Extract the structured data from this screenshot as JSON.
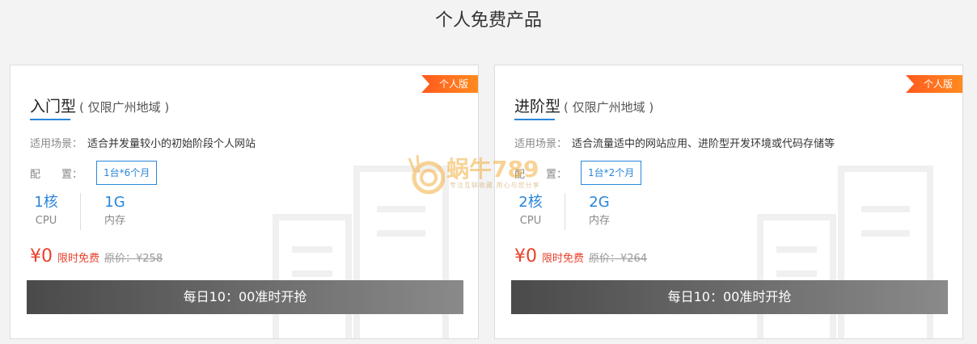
{
  "page": {
    "title": "个人免费产品"
  },
  "cards": [
    {
      "badge": "个人版",
      "name": "入门型",
      "region": "( 仅限广州地域 )",
      "scene_label": "适用场景：",
      "scene_value": "适合并发量较小的初始阶段个人网站",
      "config_label": "配　　置：",
      "config_option": "1台*6个月",
      "cpu_value": "1核",
      "cpu_label": "CPU",
      "mem_value": "1G",
      "mem_label": "内存",
      "price": "¥0",
      "free_label": "限时免费",
      "original_price": "原价：¥258",
      "button": "每日10：00准时开抢"
    },
    {
      "badge": "个人版",
      "name": "进阶型",
      "region": "( 仅限广州地域 )",
      "scene_label": "适用场景：",
      "scene_value": "适合流量适中的网站应用、进阶型开发环境或代码存储等",
      "config_label": "配　　置：",
      "config_option": "1台*2个月",
      "cpu_value": "2核",
      "cpu_label": "CPU",
      "mem_value": "2G",
      "mem_label": "内存",
      "price": "¥0",
      "free_label": "限时免费",
      "original_price": "原价：¥264",
      "button": "每日10：00准时开抢"
    }
  ],
  "watermark": {
    "text": "蜗牛789",
    "sub": "专注互联收藏 用心与您分享"
  },
  "colors": {
    "accent": "#2a86d8",
    "price": "#e8402a",
    "badge": "#ff6a1f"
  }
}
